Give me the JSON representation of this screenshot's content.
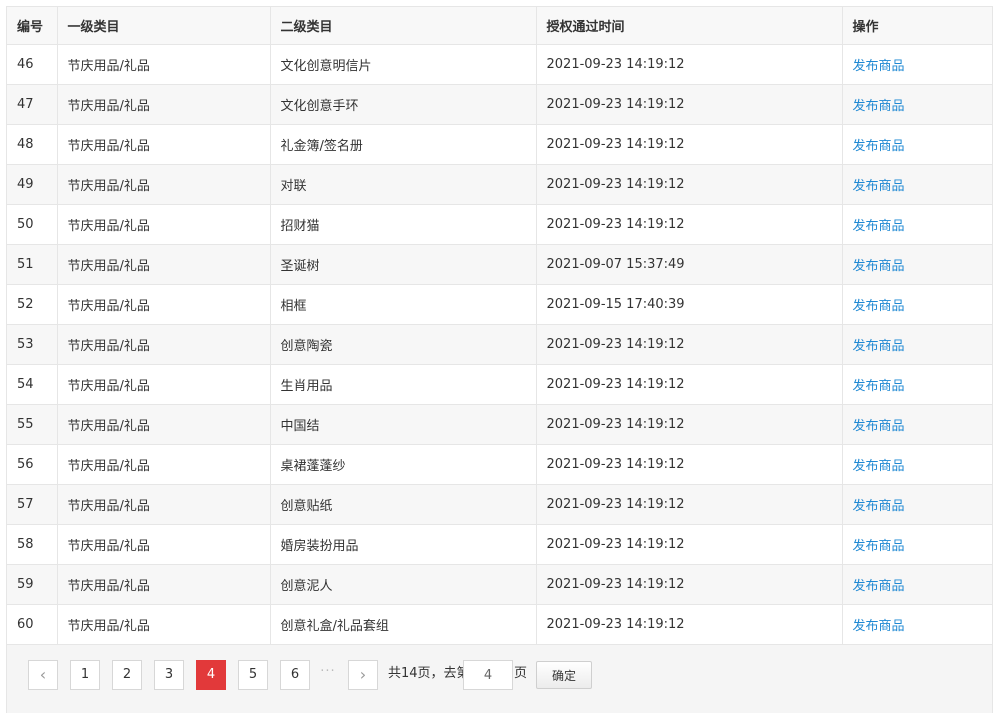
{
  "table": {
    "headers": [
      "编号",
      "一级类目",
      "二级类目",
      "授权通过时间",
      "操作"
    ],
    "rows": [
      {
        "id": "46",
        "cat1": "节庆用品/礼品",
        "cat2": "文化创意明信片",
        "time": "2021-09-23 14:19:12",
        "action": "发布商品"
      },
      {
        "id": "47",
        "cat1": "节庆用品/礼品",
        "cat2": "文化创意手环",
        "time": "2021-09-23 14:19:12",
        "action": "发布商品"
      },
      {
        "id": "48",
        "cat1": "节庆用品/礼品",
        "cat2": "礼金簿/签名册",
        "time": "2021-09-23 14:19:12",
        "action": "发布商品"
      },
      {
        "id": "49",
        "cat1": "节庆用品/礼品",
        "cat2": "对联",
        "time": "2021-09-23 14:19:12",
        "action": "发布商品"
      },
      {
        "id": "50",
        "cat1": "节庆用品/礼品",
        "cat2": "招财猫",
        "time": "2021-09-23 14:19:12",
        "action": "发布商品"
      },
      {
        "id": "51",
        "cat1": "节庆用品/礼品",
        "cat2": "圣诞树",
        "time": "2021-09-07 15:37:49",
        "action": "发布商品"
      },
      {
        "id": "52",
        "cat1": "节庆用品/礼品",
        "cat2": "相框",
        "time": "2021-09-15 17:40:39",
        "action": "发布商品"
      },
      {
        "id": "53",
        "cat1": "节庆用品/礼品",
        "cat2": "创意陶瓷",
        "time": "2021-09-23 14:19:12",
        "action": "发布商品"
      },
      {
        "id": "54",
        "cat1": "节庆用品/礼品",
        "cat2": "生肖用品",
        "time": "2021-09-23 14:19:12",
        "action": "发布商品"
      },
      {
        "id": "55",
        "cat1": "节庆用品/礼品",
        "cat2": "中国结",
        "time": "2021-09-23 14:19:12",
        "action": "发布商品"
      },
      {
        "id": "56",
        "cat1": "节庆用品/礼品",
        "cat2": "桌裙蓬蓬纱",
        "time": "2021-09-23 14:19:12",
        "action": "发布商品"
      },
      {
        "id": "57",
        "cat1": "节庆用品/礼品",
        "cat2": "创意贴纸",
        "time": "2021-09-23 14:19:12",
        "action": "发布商品"
      },
      {
        "id": "58",
        "cat1": "节庆用品/礼品",
        "cat2": "婚房装扮用品",
        "time": "2021-09-23 14:19:12",
        "action": "发布商品"
      },
      {
        "id": "59",
        "cat1": "节庆用品/礼品",
        "cat2": "创意泥人",
        "time": "2021-09-23 14:19:12",
        "action": "发布商品"
      },
      {
        "id": "60",
        "cat1": "节庆用品/礼品",
        "cat2": "创意礼盒/礼品套组",
        "time": "2021-09-23 14:19:12",
        "action": "发布商品"
      }
    ]
  },
  "pagination": {
    "prev_icon": "chevron-left-icon",
    "next_icon": "chevron-right-icon",
    "pages": [
      "1",
      "2",
      "3",
      "4",
      "5",
      "6"
    ],
    "current": "4",
    "ellipsis": "···",
    "total_text": "共14页，去第",
    "goto_value": "4",
    "page_suffix": "页",
    "confirm_label": "确定",
    "active_color": "#e2393a",
    "link_color": "#1e88d3"
  }
}
